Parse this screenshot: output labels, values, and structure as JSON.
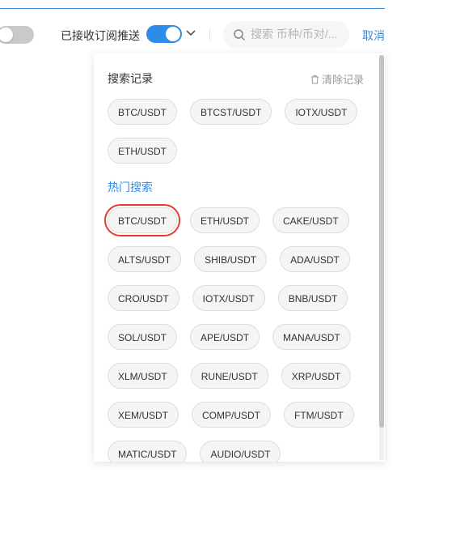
{
  "toolbar": {
    "subscription_label": "已接收订阅推送",
    "search_placeholder": "搜索 币种/币对/...",
    "cancel_label": "取消"
  },
  "dropdown": {
    "history_title": "搜索记录",
    "clear_label": "清除记录",
    "history_items": [
      "BTC/USDT",
      "BTCST/USDT",
      "IOTX/USDT",
      "ETH/USDT"
    ],
    "hot_title": "热门搜索",
    "hot_items": [
      "BTC/USDT",
      "ETH/USDT",
      "CAKE/USDT",
      "ALTS/USDT",
      "SHIB/USDT",
      "ADA/USDT",
      "CRO/USDT",
      "IOTX/USDT",
      "BNB/USDT",
      "SOL/USDT",
      "APE/USDT",
      "MANA/USDT",
      "XLM/USDT",
      "RUNE/USDT",
      "XRP/USDT",
      "XEM/USDT",
      "COMP/USDT",
      "FTM/USDT",
      "MATIC/USDT",
      "AUDIO/USDT"
    ]
  },
  "colors": {
    "accent": "#2e8ce6",
    "highlight": "#e53935"
  },
  "icons": {
    "search": "search-icon",
    "trash": "trash-icon",
    "chevron": "chevron-down-icon"
  }
}
